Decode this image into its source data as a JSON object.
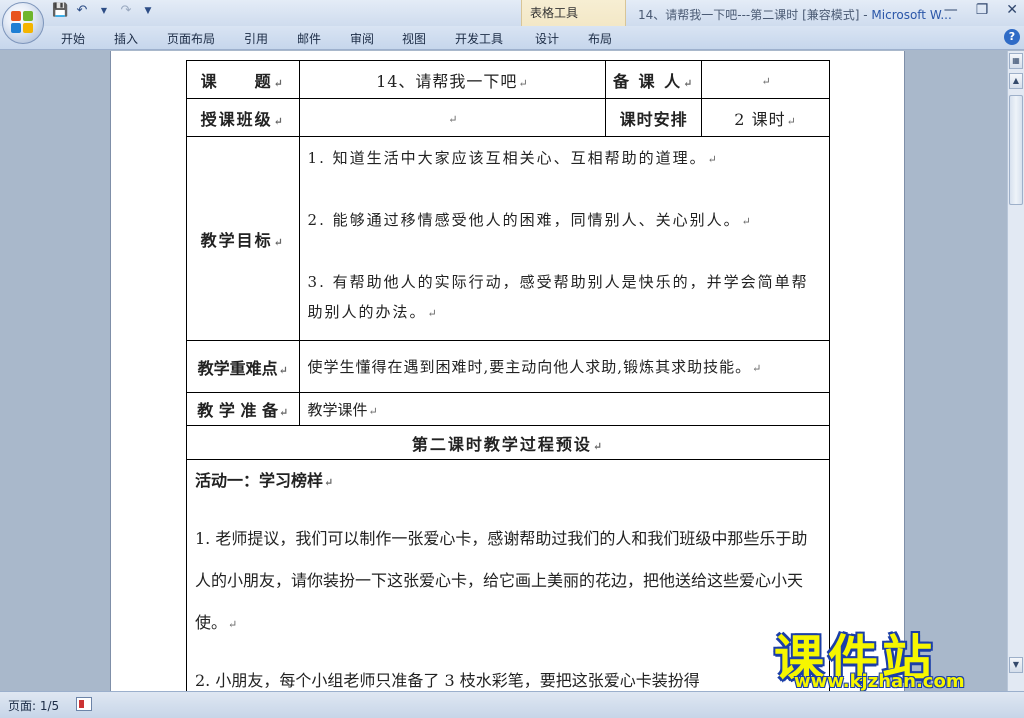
{
  "window": {
    "title_doc": "14、请帮我一下吧---第二课时 [兼容模式] - ",
    "title_app": "Microsoft W...",
    "context_tab_group": "表格工具"
  },
  "ribbon": {
    "tabs": [
      "开始",
      "插入",
      "页面布局",
      "引用",
      "邮件",
      "审阅",
      "视图",
      "开发工具",
      "设计",
      "布局"
    ]
  },
  "document": {
    "rows": {
      "topic_label": "课　　题",
      "topic_value": "14、请帮我一下吧",
      "preparer_label": "备 课 人",
      "class_label": "授课班级",
      "schedule_label": "课时安排",
      "schedule_value": "2 课时",
      "objectives_label": "教学目标",
      "objectives": [
        "1. 知道生活中大家应该互相关心、互相帮助的道理。",
        "2. 能够通过移情感受他人的困难，同情别人、关心别人。",
        "3. 有帮助他人的实际行动，感受帮助别人是快乐的，并学会简单帮助别人的办法。"
      ],
      "difficulty_label": "教学重难点",
      "difficulty_value": "使学生懂得在遇到困难时,要主动向他人求助,锻炼其求助技能。",
      "preparation_label": "教 学 准 备",
      "preparation_value": "教学课件",
      "section_title": "第二课时教学过程预设"
    },
    "activity": {
      "heading": "活动一：学习榜样",
      "paragraphs": [
        "1. 老师提议，我们可以制作一张爱心卡，感谢帮助过我们的人和我们班级中那些乐于助人的小朋友，请你装扮一下这张爱心卡，给它画上美丽的花边，把他送给这些爱心小天使。",
        "2. 小朋友，每个小组老师只准备了 3 枝水彩笔，要把这张爱心卡装扮得"
      ]
    }
  },
  "watermark": {
    "title": "课件站",
    "url": "www.kjzhan.com"
  },
  "statusbar": {
    "page": "页面: 1/5"
  },
  "colors": {
    "ribbon": "#cfdcee",
    "workspace": "#a9b8cb",
    "watermark_fill": "#f6f600",
    "watermark_outline": "#1b3ea8"
  }
}
